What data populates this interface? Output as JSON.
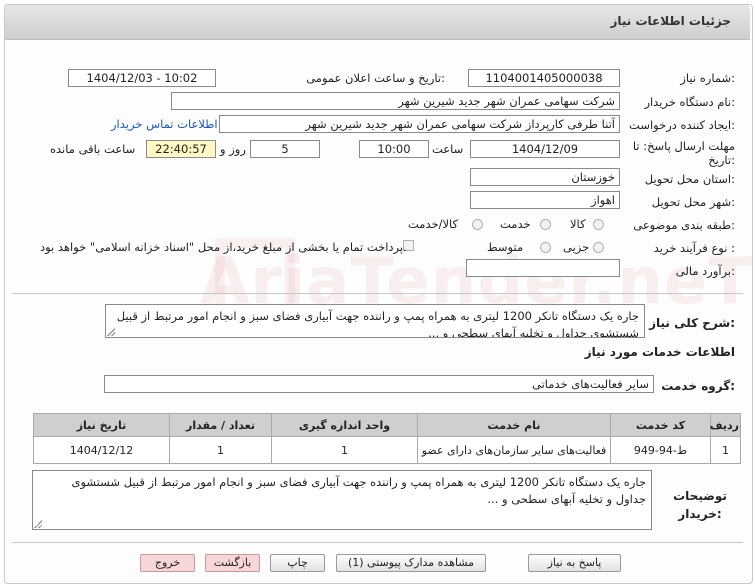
{
  "header": {
    "title": "جزئیات اطلاعات نیاز"
  },
  "watermark": {
    "text": "AriaTender.neT"
  },
  "fields": {
    "need_number_label": "شماره نیاز:",
    "need_number": "1104001405000038",
    "announce_label": "تاریخ و ساعت اعلان عمومی:",
    "announce_value": "1404/12/03 - 10:02",
    "buyer_label": "نام دستگاه خریدار:",
    "buyer_value": "شرکت سهامی عمران شهر جدید شیرین شهر",
    "creator_label": "ایجاد کننده درخواست:",
    "creator_value": "آتنا طرفی کارپرداز شرکت سهامی عمران شهر جدید شیرین شهر",
    "contact_link": "اطلاعات تماس خریدار",
    "deadline_label": "مهلت ارسال پاسخ: تا تاریخ:",
    "deadline_date": "1404/12/09",
    "time_label": "ساعت",
    "deadline_time": "10:00",
    "days_value": "5",
    "days_label": "روز و",
    "remaining_time": "22:40:57",
    "remaining_label": "ساعت باقی مانده",
    "province_label": "استان محل تحویل:",
    "province_value": "خوزستان",
    "city_label": "شهر محل تحویل:",
    "city_value": "اهواز",
    "category_label": "طبقه بندی موضوعی:",
    "category_options": [
      "کالا",
      "خدمت",
      "کالا/خدمت"
    ],
    "process_label": "نوع فرآیند خرید :",
    "process_options": [
      "جزیی",
      "متوسط"
    ],
    "payment_note": "پرداخت تمام یا بخشی از مبلغ خرید،از محل \"اسناد خزانه اسلامی\" خواهد بود.",
    "budget_label": "برآورد مالی:",
    "budget_value": ""
  },
  "description": {
    "label": "شرح کلی نیاز:",
    "text": "جاره یک دستگاه تانکر 1200 لیتری به همراه پمپ و راننده جهت آبیاری فضای سبز و انجام امور مرتبط از قبیل شستشوی جداول و تخلیه آبهای سطحی و ..."
  },
  "services": {
    "section_title": "اطلاعات خدمات مورد نیاز",
    "group_label": "گروه خدمت:",
    "group_value": "سایر فعالیت‌های خدماتی",
    "columns": [
      "ردیف",
      "کد خدمت",
      "نام خدمت",
      "واحد اندازه گیری",
      "تعداد / مقدار",
      "تاریخ نیاز"
    ],
    "rows": [
      [
        "1",
        "ط-94-949",
        "فعالیت‌های سایر سازمان‌های دارای عضو",
        "1",
        "1",
        "1404/12/12"
      ]
    ]
  },
  "buyer_notes": {
    "label": "توضیحات خریدار:",
    "text": "جاره یک دستگاه تانکر 1200 لیتری به همراه پمپ و راننده جهت آبیاری فضای سبز و انجام امور مرتبط از قبیل شستشوی جداول و تخلیه آبهای سطحی و ..."
  },
  "buttons": {
    "reply": "پاسخ به نیاز",
    "attachments": "مشاهده مدارک پیوستی (1)",
    "print": "چاپ",
    "back": "بازگشت",
    "exit": "خروج"
  }
}
